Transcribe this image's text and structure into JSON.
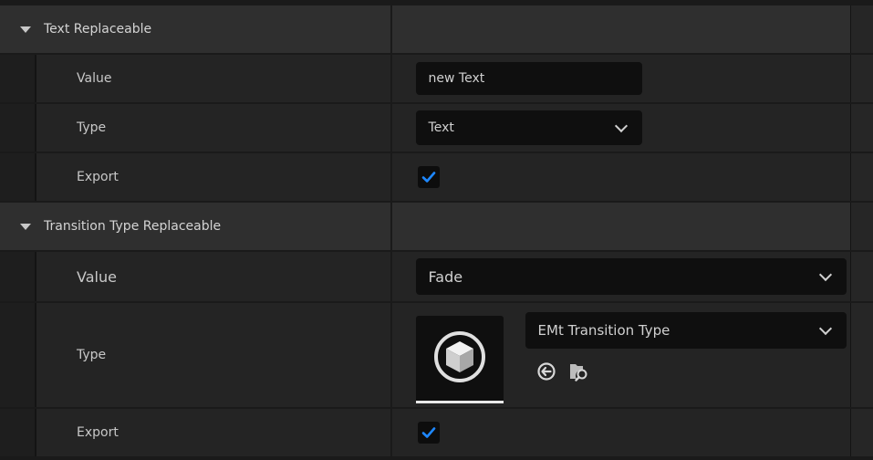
{
  "categories": [
    {
      "label": "Text Replaceable",
      "properties": {
        "value": {
          "label": "Value",
          "text": "new Text"
        },
        "type": {
          "label": "Type",
          "selected": "Text"
        },
        "export": {
          "label": "Export",
          "checked": true
        }
      }
    },
    {
      "label": "Transition Type Replaceable",
      "properties": {
        "value": {
          "label": "Value",
          "selected": "Fade"
        },
        "type": {
          "label": "Type",
          "selected": "EMt Transition Type",
          "thumbnail_icon": "cube-icon",
          "actions": [
            "use-selected-arrow-icon",
            "browse-folder-icon"
          ]
        },
        "export": {
          "label": "Export",
          "checked": true
        }
      }
    }
  ],
  "colors": {
    "accent": "#1e88ff",
    "background": "#1a1a1a",
    "category_bg": "#2f2f2f",
    "row_bg": "#242424",
    "field_bg": "#0f0f0f"
  }
}
